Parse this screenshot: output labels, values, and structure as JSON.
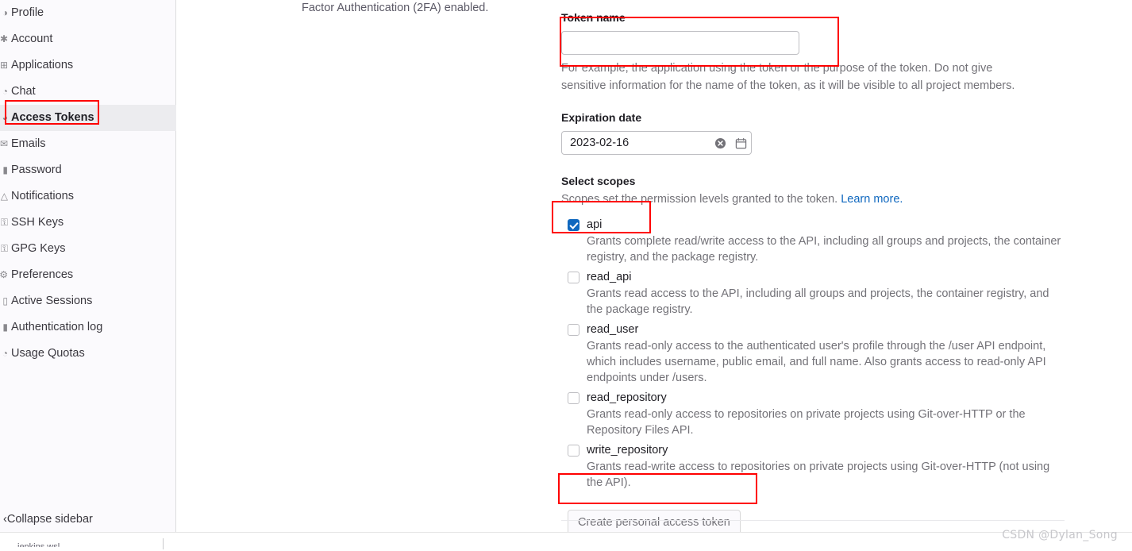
{
  "sidebar": {
    "items": [
      {
        "label": "Profile",
        "icon": "user-icon",
        "icon_glyph": "◑",
        "active": false
      },
      {
        "label": "Account",
        "icon": "account-icon",
        "icon_glyph": "✱",
        "active": false
      },
      {
        "label": "Applications",
        "icon": "apps-icon",
        "icon_glyph": "⊞",
        "active": false
      },
      {
        "label": "Chat",
        "icon": "chat-icon",
        "icon_glyph": "◔",
        "active": false
      },
      {
        "label": "Access Tokens",
        "icon": "token-icon",
        "icon_glyph": "◕",
        "active": true
      },
      {
        "label": "Emails",
        "icon": "envelope-icon",
        "icon_glyph": "✉",
        "active": false
      },
      {
        "label": "Password",
        "icon": "lock-icon",
        "icon_glyph": "▮",
        "active": false
      },
      {
        "label": "Notifications",
        "icon": "bell-icon",
        "icon_glyph": "△",
        "active": false
      },
      {
        "label": "SSH Keys",
        "icon": "key-icon",
        "icon_glyph": "⚿",
        "active": false
      },
      {
        "label": "GPG Keys",
        "icon": "key-icon",
        "icon_glyph": "⚿",
        "active": false
      },
      {
        "label": "Preferences",
        "icon": "sliders-icon",
        "icon_glyph": "⚙",
        "active": false
      },
      {
        "label": "Active Sessions",
        "icon": "monitor-icon",
        "icon_glyph": "▯",
        "active": false
      },
      {
        "label": "Authentication log",
        "icon": "log-icon",
        "icon_glyph": "▮",
        "active": false
      },
      {
        "label": "Usage Quotas",
        "icon": "gauge-icon",
        "icon_glyph": "◔",
        "active": false
      }
    ],
    "collapse_label": "Collapse sidebar",
    "collapse_icon": "chevron-left-icon"
  },
  "main": {
    "intro_fragment": "Factor Authentication (2FA) enabled.",
    "token_name": {
      "label": "Token name",
      "value": "",
      "placeholder": "",
      "help": "For example, the application using the token or the purpose of the token. Do not give sensitive information for the name of the token, as it will be visible to all project members."
    },
    "expiration": {
      "label": "Expiration date",
      "value": "2023-02-16",
      "clear_icon": "clear-circle-icon",
      "calendar_icon": "calendar-icon"
    },
    "scopes": {
      "label": "Select scopes",
      "help_text": "Scopes set the permission levels granted to the token.",
      "help_link": "Learn more.",
      "link_color": "#1068bf",
      "items": [
        {
          "name": "api",
          "checked": true,
          "description": "Grants complete read/write access to the API, including all groups and projects, the container registry, and the package registry."
        },
        {
          "name": "read_api",
          "checked": false,
          "description": "Grants read access to the API, including all groups and projects, the container registry, and the package registry."
        },
        {
          "name": "read_user",
          "checked": false,
          "description": "Grants read-only access to the authenticated user's profile through the /user API endpoint, which includes username, public email, and full name. Also grants access to read-only API endpoints under /users."
        },
        {
          "name": "read_repository",
          "checked": false,
          "description": "Grants read-only access to repositories on private projects using Git-over-HTTP or the Repository Files API."
        },
        {
          "name": "write_repository",
          "checked": false,
          "description": "Grants read-write access to repositories on private projects using Git-over-HTTP (not using the API)."
        }
      ]
    },
    "create_button_label": "Create personal access token"
  },
  "annotations": {
    "color": "#ff0000",
    "boxes": [
      "access-tokens-nav",
      "token-name-field",
      "api-scope-checkbox",
      "create-token-button"
    ]
  },
  "watermark": "CSDN @Dylan_Song",
  "tab_remnant": "jenkins.wsl"
}
